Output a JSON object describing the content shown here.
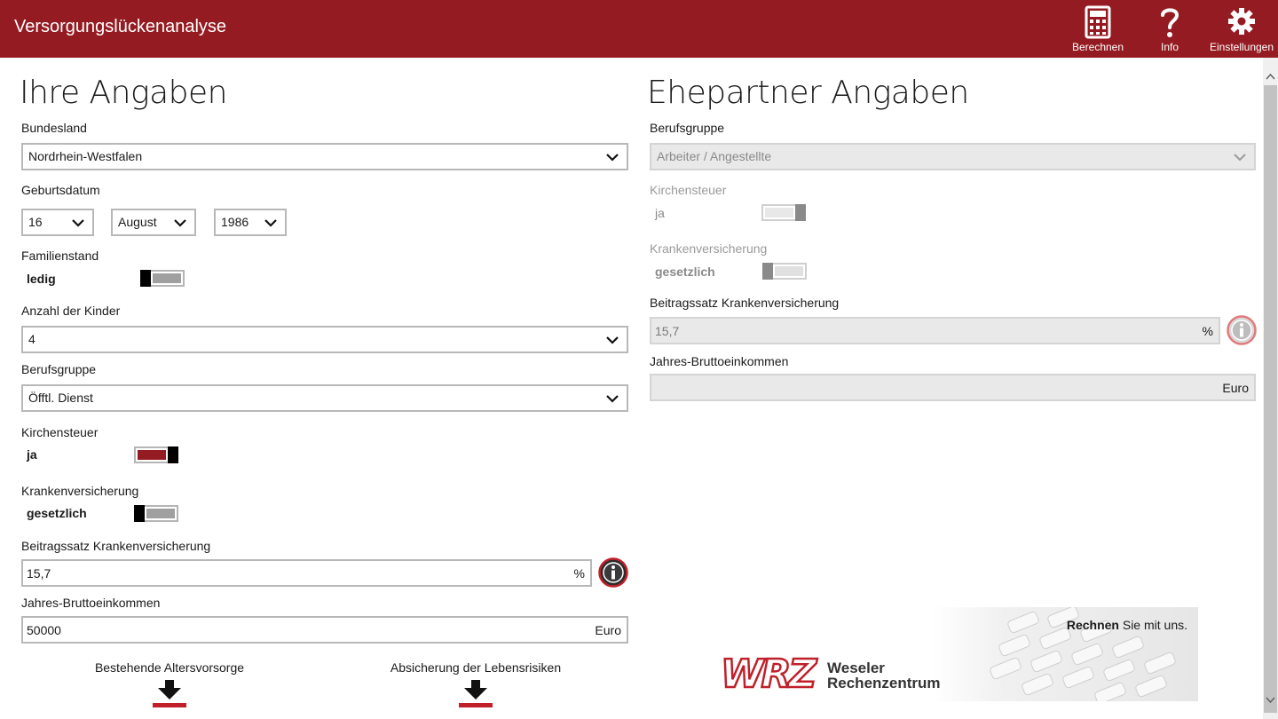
{
  "app": {
    "title": "Versorgungslückenanalyse",
    "commands": [
      {
        "label": "Berechnen",
        "icon": "calculator-icon"
      },
      {
        "label": "Info",
        "icon": "question-icon"
      },
      {
        "label": "Einstellungen",
        "icon": "gear-icon"
      }
    ],
    "accent": "#951b22"
  },
  "own": {
    "heading": "Ihre Angaben",
    "bundesland": {
      "label": "Bundesland",
      "value": "Nordrhein-Westfalen"
    },
    "geburtsdatum": {
      "label": "Geburtsdatum",
      "day": "16",
      "month": "August",
      "year": "1986"
    },
    "familienstand": {
      "label": "Familienstand",
      "value": "ledig",
      "on": false
    },
    "kinder": {
      "label": "Anzahl der Kinder",
      "value": "4"
    },
    "berufsgruppe": {
      "label": "Berufsgruppe",
      "value": "Öfftl. Dienst"
    },
    "kirchensteuer": {
      "label": "Kirchensteuer",
      "value": "ja",
      "on": true
    },
    "krankenversicherung": {
      "label": "Krankenversicherung",
      "value": "gesetzlich",
      "on": false
    },
    "beitragssatz": {
      "label": "Beitragssatz Krankenversicherung",
      "value": "15,7",
      "unit": "%"
    },
    "einkommen": {
      "label": "Jahres-Bruttoeinkommen",
      "value": "50000",
      "unit": "Euro"
    },
    "links": [
      {
        "label": "Bestehende Altersvorsorge",
        "icon": "download-arrow-icon"
      },
      {
        "label": "Absicherung der Lebensrisiken",
        "icon": "download-arrow-icon"
      }
    ]
  },
  "partner": {
    "heading": "Ehepartner Angaben",
    "berufsgruppe": {
      "label": "Berufsgruppe",
      "value": "Arbeiter / Angestellte"
    },
    "kirchensteuer": {
      "label": "Kirchensteuer",
      "value": "ja",
      "on": true
    },
    "krankenversicherung": {
      "label": "Krankenversicherung",
      "value": "gesetzlich",
      "on": false
    },
    "beitragssatz": {
      "label": "Beitragssatz Krankenversicherung",
      "value": "15,7",
      "unit": "%"
    },
    "einkommen": {
      "label": "Jahres-Bruttoeinkommen",
      "value": "",
      "unit": "Euro"
    }
  },
  "banner": {
    "tagline_bold": "Rechnen",
    "tagline_rest": " Sie mit uns.",
    "logo_mark": "WRZ",
    "logo_line1": "Weseler",
    "logo_line2": "Rechenzentrum"
  }
}
